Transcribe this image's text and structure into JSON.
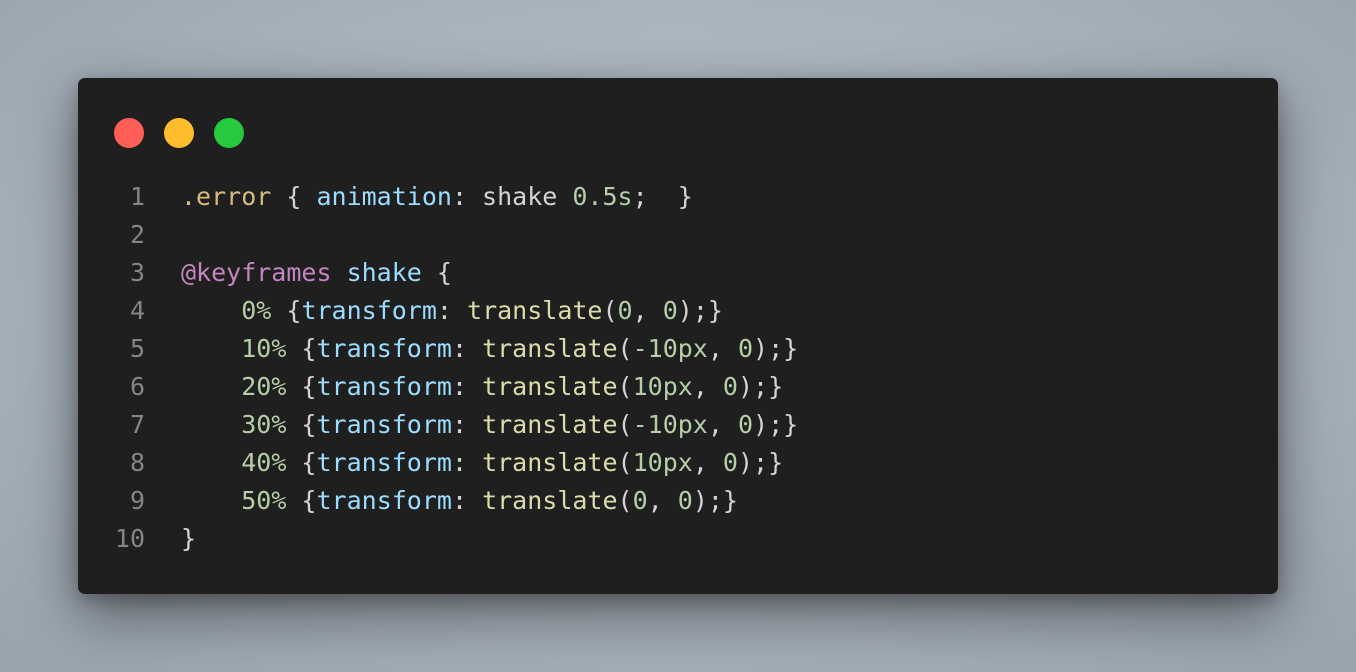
{
  "window_controls": [
    {
      "name": "close-dot",
      "color": "#ff5f56"
    },
    {
      "name": "minimize-dot",
      "color": "#ffbd2e"
    },
    {
      "name": "maximize-dot",
      "color": "#27c93f"
    }
  ],
  "colors": {
    "selector": "#d7ba7d",
    "property": "#9cdcfe",
    "value": "#d4d4d4",
    "number": "#b5cea8",
    "at_rule": "#c586c0",
    "function": "#dcdcaa",
    "punct": "#d4d4d4",
    "line_number": "#858585"
  },
  "code": {
    "lines": [
      {
        "n": "1",
        "tokens": [
          {
            "t": ".error",
            "c": "selector"
          },
          {
            "t": " { ",
            "c": "punct"
          },
          {
            "t": "animation",
            "c": "property"
          },
          {
            "t": ": ",
            "c": "punct"
          },
          {
            "t": "shake",
            "c": "value"
          },
          {
            "t": " ",
            "c": "punct"
          },
          {
            "t": "0.5s",
            "c": "number"
          },
          {
            "t": ";  }",
            "c": "punct"
          }
        ]
      },
      {
        "n": "2",
        "tokens": []
      },
      {
        "n": "3",
        "tokens": [
          {
            "t": "@keyframes",
            "c": "at_rule"
          },
          {
            "t": " ",
            "c": "punct"
          },
          {
            "t": "shake",
            "c": "property"
          },
          {
            "t": " {",
            "c": "punct"
          }
        ]
      },
      {
        "n": "4",
        "tokens": [
          {
            "t": "    ",
            "c": "punct"
          },
          {
            "t": "0%",
            "c": "number"
          },
          {
            "t": " {",
            "c": "punct"
          },
          {
            "t": "transform",
            "c": "property"
          },
          {
            "t": ": ",
            "c": "punct"
          },
          {
            "t": "translate",
            "c": "function"
          },
          {
            "t": "(",
            "c": "punct"
          },
          {
            "t": "0",
            "c": "number"
          },
          {
            "t": ", ",
            "c": "punct"
          },
          {
            "t": "0",
            "c": "number"
          },
          {
            "t": ");}",
            "c": "punct"
          }
        ]
      },
      {
        "n": "5",
        "tokens": [
          {
            "t": "    ",
            "c": "punct"
          },
          {
            "t": "10%",
            "c": "number"
          },
          {
            "t": " {",
            "c": "punct"
          },
          {
            "t": "transform",
            "c": "property"
          },
          {
            "t": ": ",
            "c": "punct"
          },
          {
            "t": "translate",
            "c": "function"
          },
          {
            "t": "(",
            "c": "punct"
          },
          {
            "t": "-10px",
            "c": "number"
          },
          {
            "t": ", ",
            "c": "punct"
          },
          {
            "t": "0",
            "c": "number"
          },
          {
            "t": ");}",
            "c": "punct"
          }
        ]
      },
      {
        "n": "6",
        "tokens": [
          {
            "t": "    ",
            "c": "punct"
          },
          {
            "t": "20%",
            "c": "number"
          },
          {
            "t": " {",
            "c": "punct"
          },
          {
            "t": "transform",
            "c": "property"
          },
          {
            "t": ": ",
            "c": "punct"
          },
          {
            "t": "translate",
            "c": "function"
          },
          {
            "t": "(",
            "c": "punct"
          },
          {
            "t": "10px",
            "c": "number"
          },
          {
            "t": ", ",
            "c": "punct"
          },
          {
            "t": "0",
            "c": "number"
          },
          {
            "t": ");}",
            "c": "punct"
          }
        ]
      },
      {
        "n": "7",
        "tokens": [
          {
            "t": "    ",
            "c": "punct"
          },
          {
            "t": "30%",
            "c": "number"
          },
          {
            "t": " {",
            "c": "punct"
          },
          {
            "t": "transform",
            "c": "property"
          },
          {
            "t": ": ",
            "c": "punct"
          },
          {
            "t": "translate",
            "c": "function"
          },
          {
            "t": "(",
            "c": "punct"
          },
          {
            "t": "-10px",
            "c": "number"
          },
          {
            "t": ", ",
            "c": "punct"
          },
          {
            "t": "0",
            "c": "number"
          },
          {
            "t": ");}",
            "c": "punct"
          }
        ]
      },
      {
        "n": "8",
        "tokens": [
          {
            "t": "    ",
            "c": "punct"
          },
          {
            "t": "40%",
            "c": "number"
          },
          {
            "t": " {",
            "c": "punct"
          },
          {
            "t": "transform",
            "c": "property"
          },
          {
            "t": ": ",
            "c": "punct"
          },
          {
            "t": "translate",
            "c": "function"
          },
          {
            "t": "(",
            "c": "punct"
          },
          {
            "t": "10px",
            "c": "number"
          },
          {
            "t": ", ",
            "c": "punct"
          },
          {
            "t": "0",
            "c": "number"
          },
          {
            "t": ");}",
            "c": "punct"
          }
        ]
      },
      {
        "n": "9",
        "tokens": [
          {
            "t": "    ",
            "c": "punct"
          },
          {
            "t": "50%",
            "c": "number"
          },
          {
            "t": " {",
            "c": "punct"
          },
          {
            "t": "transform",
            "c": "property"
          },
          {
            "t": ": ",
            "c": "punct"
          },
          {
            "t": "translate",
            "c": "function"
          },
          {
            "t": "(",
            "c": "punct"
          },
          {
            "t": "0",
            "c": "number"
          },
          {
            "t": ", ",
            "c": "punct"
          },
          {
            "t": "0",
            "c": "number"
          },
          {
            "t": ");}",
            "c": "punct"
          }
        ]
      },
      {
        "n": "10",
        "tokens": [
          {
            "t": "}",
            "c": "punct"
          }
        ]
      }
    ]
  }
}
